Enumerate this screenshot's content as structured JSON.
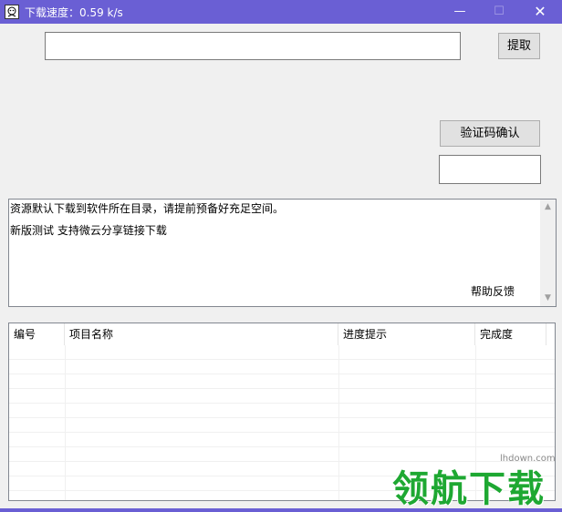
{
  "window": {
    "title": "下载速度：0.59 k/s",
    "minimize_glyph": "—",
    "maximize_glyph": "☐",
    "close_glyph": "✕"
  },
  "extract": {
    "url_value": "",
    "button_label": "提取"
  },
  "captcha": {
    "button_label": "验证码确认",
    "input_value": ""
  },
  "info": {
    "line1": "资源默认下载到软件所在目录，请提前预备好充足空间。",
    "line2": "新版测试 支持微云分享链接下载",
    "help_label": "帮助反馈"
  },
  "list": {
    "columns": [
      "编号",
      "项目名称",
      "进度提示",
      "完成度"
    ]
  },
  "watermark": {
    "text": "领航下载",
    "url": "lhdown.com"
  },
  "colors": {
    "titlebar": "#6a5fd4",
    "window_bg": "#f0f0f0",
    "watermark_green": "#1ea832"
  }
}
